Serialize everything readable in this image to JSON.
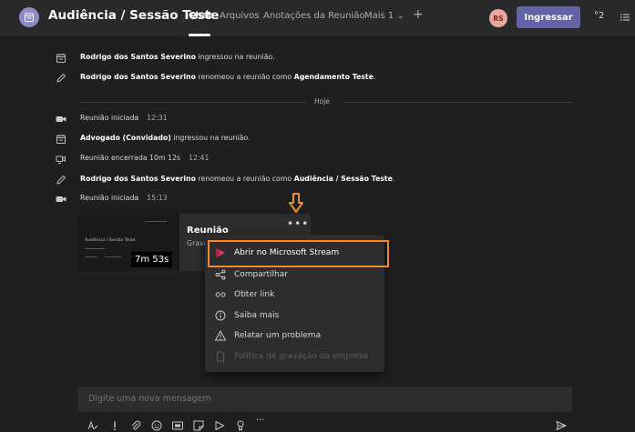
{
  "header": {
    "title": "Audiência / Sessão Teste",
    "tabs": [
      {
        "label": "Chat",
        "active": true
      },
      {
        "label": "Arquivos",
        "active": false
      },
      {
        "label": "Anotações da Reunião",
        "active": false
      },
      {
        "label": "Mais 1 ⌄",
        "active": false
      }
    ],
    "add_tab": "+",
    "avatar_initials": "RS",
    "join_label": "Ingressar",
    "participants": "°2",
    "accent": "#6264a7"
  },
  "feed": {
    "events": [
      {
        "icon": "calendar-icon",
        "bold": "Rodrigo dos Santos Severino",
        "text": " ingressou na reunião.",
        "bold2": "",
        "end": "",
        "time": ""
      },
      {
        "icon": "pencil-icon",
        "bold": "Rodrigo dos Santos Severino",
        "text": " renomeou a reunião como ",
        "bold2": "Agendamento Teste",
        "end": ".",
        "time": ""
      },
      {
        "icon": "camera-icon",
        "bold": "",
        "text": "Reunião iniciada",
        "bold2": "",
        "end": "",
        "time": "12:31"
      },
      {
        "icon": "calendar-icon",
        "bold": "Advogado (Convidado)",
        "text": " ingressou na reunião.",
        "bold2": "",
        "end": "",
        "time": ""
      },
      {
        "icon": "meeting-ended-icon",
        "bold": "",
        "text": "Reunião encerrada  10m 12s",
        "bold2": "",
        "end": "",
        "time": "12:41"
      },
      {
        "icon": "pencil-icon",
        "bold": "Rodrigo dos Santos Severino",
        "text": " renomeou a reunião como ",
        "bold2": "Audiência / Sessão Teste",
        "end": ".",
        "time": ""
      },
      {
        "icon": "camera-icon",
        "bold": "",
        "text": "Reunião iniciada",
        "bold2": "",
        "end": "",
        "time": "15:13"
      }
    ],
    "today_label": "Hoje"
  },
  "recording": {
    "thumb_title": "Audiência / Sessão Teste",
    "duration": "7m 53s",
    "title": "Reunião",
    "subtitle": "Grava",
    "more": "•••"
  },
  "context_menu": {
    "items": [
      {
        "label": "Abrir no Microsoft Stream",
        "icon": "stream-icon",
        "disabled": false
      },
      {
        "label": "Compartilhar",
        "icon": "share-icon",
        "disabled": false
      },
      {
        "label": "Obter link",
        "icon": "link-icon",
        "disabled": false
      },
      {
        "label": "Saiba mais",
        "icon": "info-icon",
        "disabled": false
      },
      {
        "label": "Relatar um problema",
        "icon": "warning-icon",
        "disabled": false
      },
      {
        "label": "Política de gravação da empresa",
        "icon": "document-icon",
        "disabled": true
      }
    ],
    "highlight_color": "#f08a2a"
  },
  "compose": {
    "placeholder": "Digite uma nova mensagem",
    "more_options": "···"
  }
}
